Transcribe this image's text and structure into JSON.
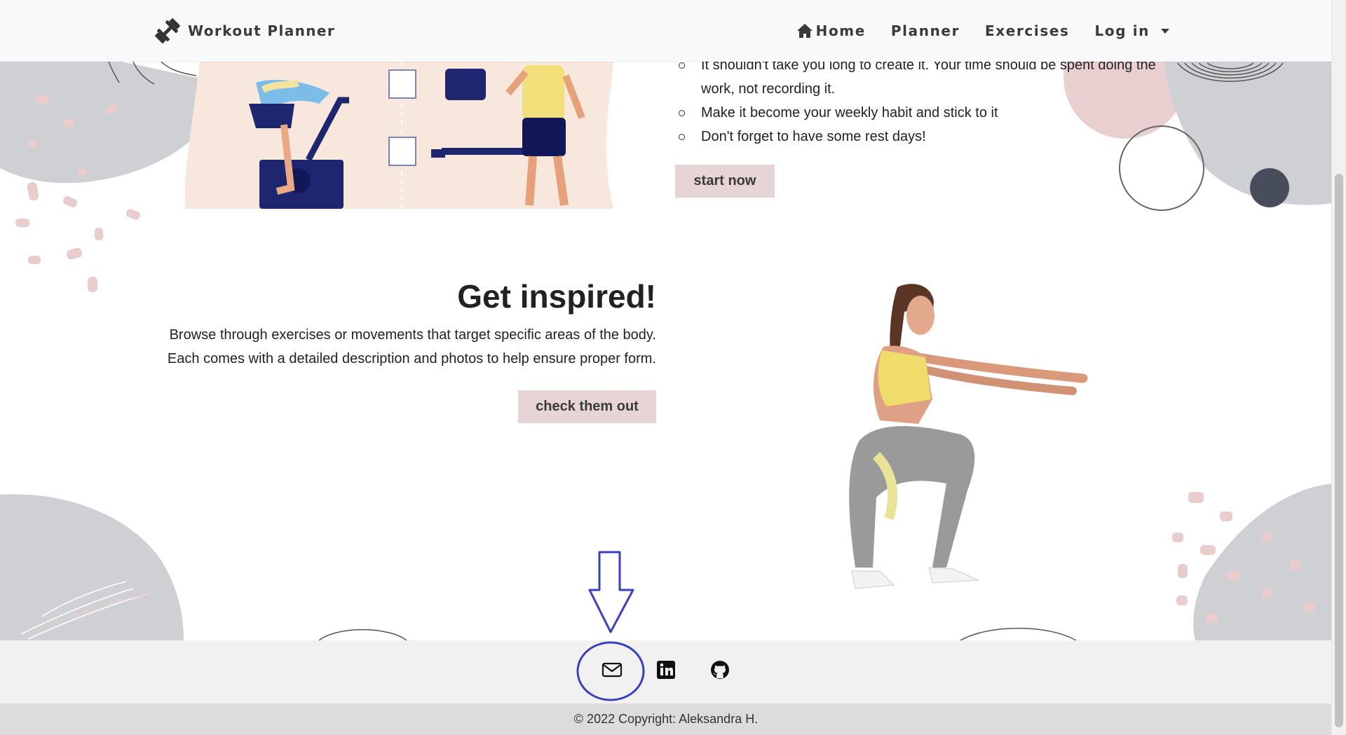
{
  "navbar": {
    "brand": "Workout Planner",
    "links": {
      "home": "Home",
      "planner": "Planner",
      "exercises": "Exercises",
      "login": "Log in"
    }
  },
  "section_plan": {
    "items": [
      "It shouldn't take you long to create it. Your time should be spent doing the work, not recording it.",
      "Make it become your weekly habit and stick to it",
      "Don't forget to have some rest days!"
    ],
    "button": "start now"
  },
  "section_inspired": {
    "title": "Get inspired!",
    "lines": [
      "Browse through exercises or movements that target specific areas of the body.",
      "Each comes with a detailed description and photos to help ensure proper form."
    ],
    "button": "check them out"
  },
  "footer": {
    "icons": [
      "envelope-icon",
      "linkedin-icon",
      "github-icon"
    ],
    "copyright": "© 2022 Copyright: Aleksandra H."
  },
  "colors": {
    "button_bg": "#e7d4d4",
    "navbar_bg": "#f8f9fa",
    "footer_bg": "#f1f1f1",
    "annotation": "#3a3fc0"
  }
}
